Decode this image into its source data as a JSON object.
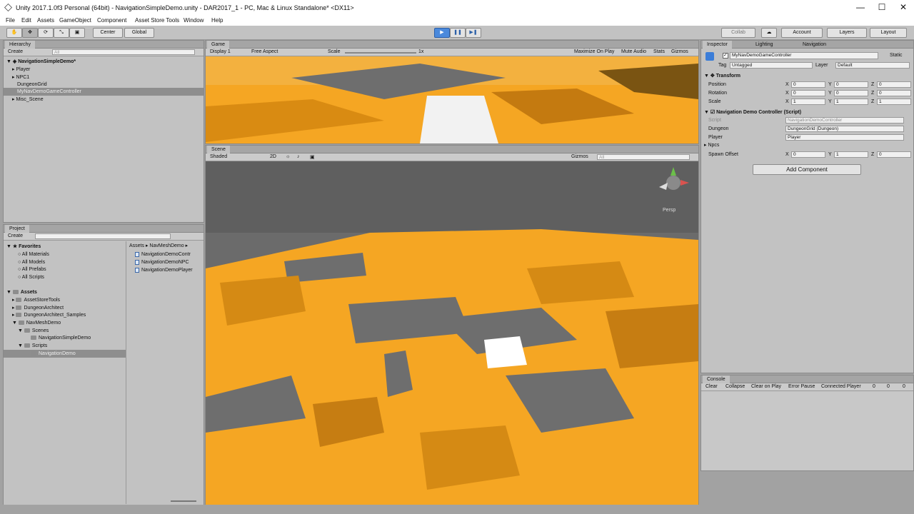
{
  "window": {
    "title": "Unity 2017.1.0f3 Personal (64bit) - NavigationSimpleDemo.unity - DAR2017_1 - PC, Mac & Linux Standalone* <DX11>",
    "minimize": "—",
    "maximize": "☐",
    "close": "✕"
  },
  "menu": [
    "File",
    "Edit",
    "Assets",
    "GameObject",
    "Component",
    "Asset Store Tools",
    "Window",
    "Help"
  ],
  "toolbar": {
    "center": "Center",
    "global": "Global",
    "collab": "Collab",
    "account": "Account",
    "layers": "Layers",
    "layout": "Layout"
  },
  "hierarchy": {
    "tab": "Hierarchy",
    "create": "Create",
    "search": "All",
    "scene": "NavigationSimpleDemo*",
    "items": [
      "Player",
      "NPC1",
      "DungeonGrid",
      "MyNavDemoGameController",
      "Misc_Scene"
    ]
  },
  "game": {
    "tab": "Game",
    "display": "Display 1",
    "aspect": "Free Aspect",
    "scale_label": "Scale",
    "scale_value": "1x",
    "maximize": "Maximize On Play",
    "mute": "Mute Audio",
    "stats": "Stats",
    "gizmos": "Gizmos"
  },
  "scene": {
    "tab": "Scene",
    "shading": "Shaded",
    "mode2d": "2D",
    "gizmos": "Gizmos",
    "search": "All",
    "persp": "Persp"
  },
  "project": {
    "tab": "Project",
    "create": "Create",
    "favorites": "Favorites",
    "fav_items": [
      "All Materials",
      "All Models",
      "All Prefabs",
      "All Scripts"
    ],
    "assets": "Assets",
    "asset_tree": [
      "AssetStoreTools",
      "DungeonArchitect",
      "DungeonArchitect_Samples",
      "NavMeshDemo",
      "Scenes",
      "NavigationSimpleDemo",
      "Scripts",
      "NavigationDemo"
    ],
    "breadcrumb": "Assets ▸ NavMeshDemo ▸",
    "files": [
      "NavigationDemoContr",
      "NavigationDemoNPC",
      "NavigationDemoPlayer"
    ]
  },
  "inspector": {
    "tabs": [
      "Inspector",
      "Lighting",
      "Navigation"
    ],
    "object_name": "MyNavDemoGameController",
    "static": "Static",
    "tag_label": "Tag",
    "tag": "Untagged",
    "layer_label": "Layer",
    "layer": "Default",
    "transform": "Transform",
    "position": "Position",
    "rotation": "Rotation",
    "scale": "Scale",
    "pos": [
      "0",
      "0",
      "0"
    ],
    "rot": [
      "0",
      "0",
      "0"
    ],
    "scl": [
      "1",
      "1",
      "1"
    ],
    "x": "X",
    "y": "Y",
    "z": "Z",
    "component": "Navigation Demo Controller (Script)",
    "script_label": "Script",
    "script": "NavigationDemoController",
    "dungeon_label": "Dungeon",
    "dungeon": "DungeonGrid (Dungeon)",
    "player_label": "Player",
    "player": "Player",
    "npcs": "Npcs",
    "spawn_label": "Spawn Offset",
    "spawn": [
      "0",
      "1",
      "0"
    ],
    "add_component": "Add Component"
  },
  "console": {
    "tab": "Console",
    "buttons": [
      "Clear",
      "Collapse",
      "Clear on Play",
      "Error Pause",
      "Connected Player"
    ],
    "counts": [
      "0",
      "0",
      "0"
    ]
  },
  "colors": {
    "orange": "#f5a623",
    "floor": "#6e6e6e",
    "play": "#4a89dc"
  }
}
